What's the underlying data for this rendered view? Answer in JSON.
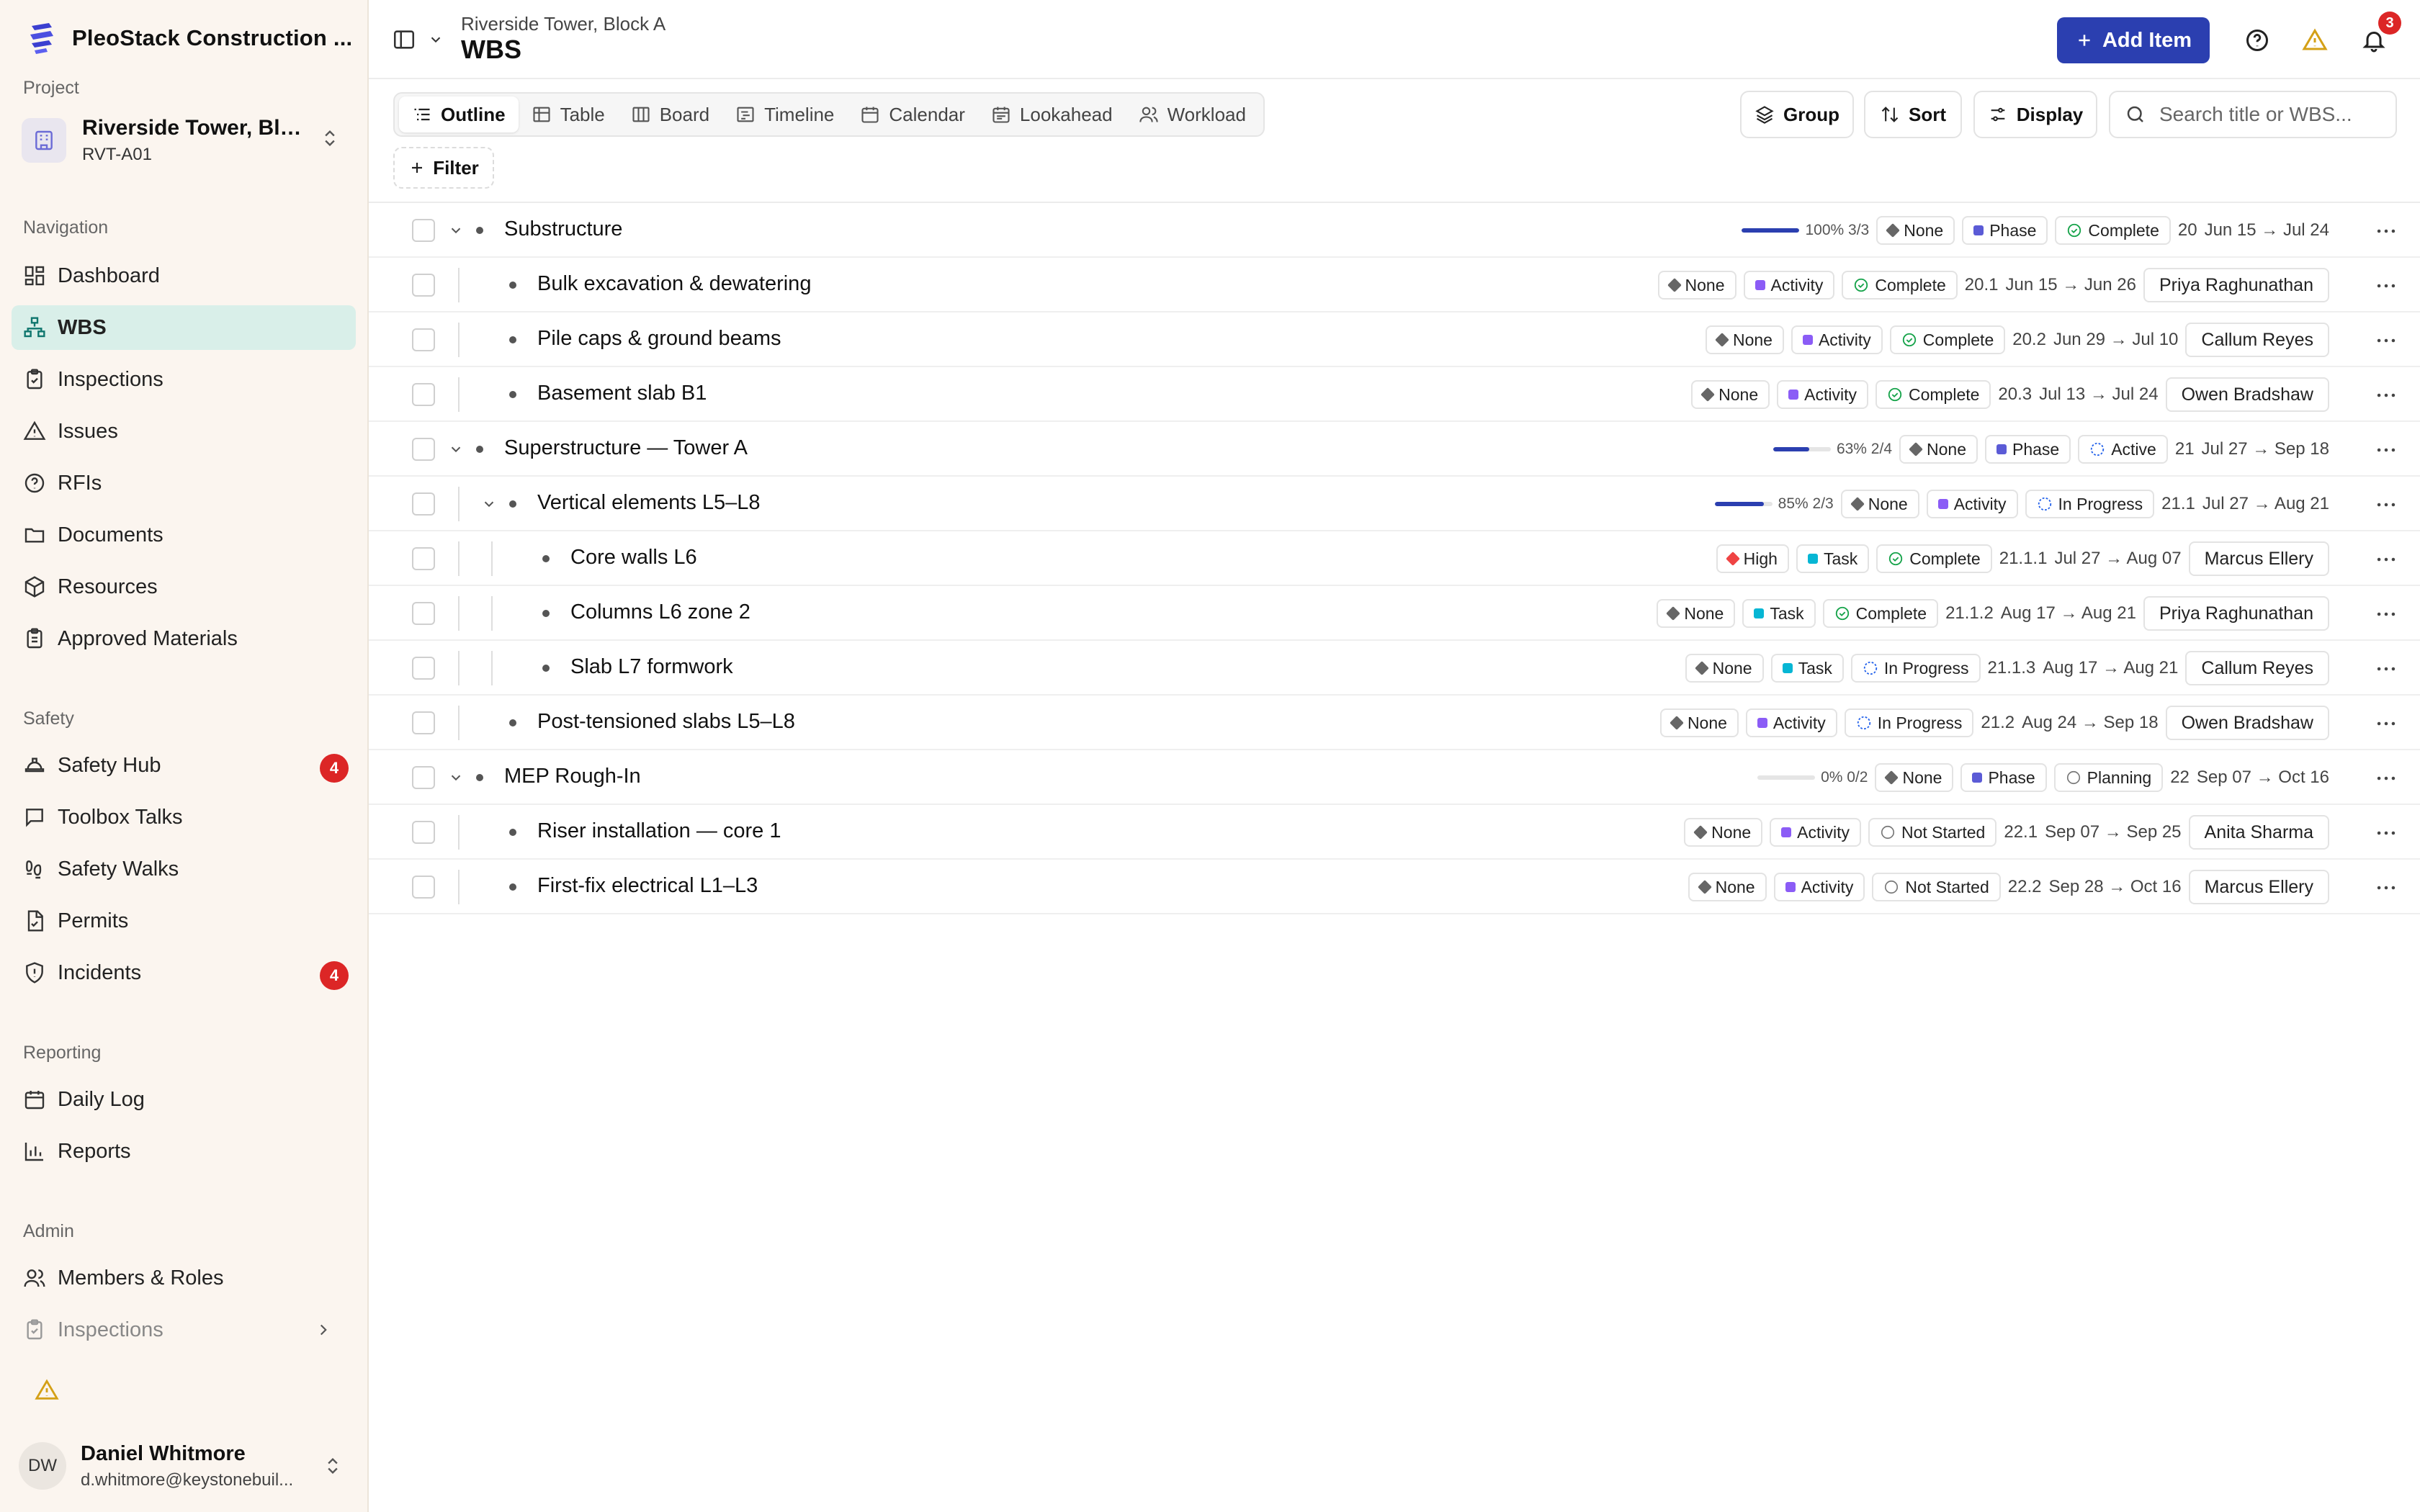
{
  "app": {
    "name": "PleoStack Construction ...",
    "notifications_count": "3"
  },
  "project": {
    "label": "Project",
    "name": "Riverside Tower, Bloc...",
    "code": "RVT-A01"
  },
  "sections": {
    "navigation": "Navigation",
    "safety": "Safety",
    "reporting": "Reporting",
    "admin": "Admin"
  },
  "nav": {
    "dashboard": "Dashboard",
    "wbs": "WBS",
    "inspections": "Inspections",
    "issues": "Issues",
    "rfis": "RFIs",
    "documents": "Documents",
    "resources": "Resources",
    "approved_materials": "Approved Materials",
    "safety_hub": "Safety Hub",
    "safety_hub_badge": "4",
    "toolbox_talks": "Toolbox Talks",
    "safety_walks": "Safety Walks",
    "permits": "Permits",
    "incidents": "Incidents",
    "incidents_badge": "4",
    "daily_log": "Daily Log",
    "reports": "Reports",
    "members_roles": "Members & Roles",
    "admin_inspections": "Inspections"
  },
  "user": {
    "initials": "DW",
    "name": "Daniel Whitmore",
    "email": "d.whitmore@keystonebuil..."
  },
  "header": {
    "breadcrumb": "Riverside Tower, Block A",
    "title": "WBS",
    "add_button": "Add Item"
  },
  "views": [
    "Outline",
    "Table",
    "Board",
    "Timeline",
    "Calendar",
    "Lookahead",
    "Workload"
  ],
  "toolbar": {
    "group": "Group",
    "sort": "Sort",
    "display": "Display",
    "search_placeholder": "Search title or WBS...",
    "filter": "Filter"
  },
  "colors": {
    "accent": "#2b3fb0",
    "active_nav_bg": "#d9efe9",
    "sidebar_bg": "#fbf5ef",
    "badge_red": "#dc2626",
    "phase": "#5b5bd6",
    "activity": "#8b5cf6",
    "task": "#06b6d4",
    "priority_none": "#666666",
    "priority_high": "#ef4444",
    "status_complete": "#16a34a",
    "status_active": "#2563eb"
  },
  "rows": [
    {
      "level": 0,
      "expandable": true,
      "title": "Substructure",
      "progress_pct": 100,
      "progress_text": "100% 3/3",
      "priority": "None",
      "type": "Phase",
      "status": "Complete",
      "wbs": "20",
      "dates": "Jun 15 → Jul 24",
      "assignee": ""
    },
    {
      "level": 1,
      "expandable": false,
      "title": "Bulk excavation & dewatering",
      "priority": "None",
      "type": "Activity",
      "status": "Complete",
      "wbs": "20.1",
      "dates": "Jun 15 → Jun 26",
      "assignee": "Priya Raghunathan"
    },
    {
      "level": 1,
      "expandable": false,
      "title": "Pile caps & ground beams",
      "priority": "None",
      "type": "Activity",
      "status": "Complete",
      "wbs": "20.2",
      "dates": "Jun 29 → Jul 10",
      "assignee": "Callum Reyes"
    },
    {
      "level": 1,
      "expandable": false,
      "title": "Basement slab B1",
      "priority": "None",
      "type": "Activity",
      "status": "Complete",
      "wbs": "20.3",
      "dates": "Jul 13 → Jul 24",
      "assignee": "Owen Bradshaw"
    },
    {
      "level": 0,
      "expandable": true,
      "title": "Superstructure — Tower A",
      "progress_pct": 63,
      "progress_text": "63% 2/4",
      "priority": "None",
      "type": "Phase",
      "status": "Active",
      "wbs": "21",
      "dates": "Jul 27 → Sep 18",
      "assignee": ""
    },
    {
      "level": 1,
      "expandable": true,
      "title": "Vertical elements L5–L8",
      "progress_pct": 85,
      "progress_text": "85% 2/3",
      "priority": "None",
      "type": "Activity",
      "status": "In Progress",
      "wbs": "21.1",
      "dates": "Jul 27 → Aug 21",
      "assignee": ""
    },
    {
      "level": 2,
      "expandable": false,
      "title": "Core walls L6",
      "priority": "High",
      "type": "Task",
      "status": "Complete",
      "wbs": "21.1.1",
      "dates": "Jul 27 → Aug 07",
      "assignee": "Marcus Ellery"
    },
    {
      "level": 2,
      "expandable": false,
      "title": "Columns L6 zone 2",
      "priority": "None",
      "type": "Task",
      "status": "Complete",
      "wbs": "21.1.2",
      "dates": "Aug 17 → Aug 21",
      "assignee": "Priya Raghunathan"
    },
    {
      "level": 2,
      "expandable": false,
      "title": "Slab L7 formwork",
      "priority": "None",
      "type": "Task",
      "status": "In Progress",
      "wbs": "21.1.3",
      "dates": "Aug 17 → Aug 21",
      "assignee": "Callum Reyes"
    },
    {
      "level": 1,
      "expandable": false,
      "title": "Post-tensioned slabs L5–L8",
      "priority": "None",
      "type": "Activity",
      "status": "In Progress",
      "wbs": "21.2",
      "dates": "Aug 24 → Sep 18",
      "assignee": "Owen Bradshaw"
    },
    {
      "level": 0,
      "expandable": true,
      "title": "MEP Rough-In",
      "progress_pct": 0,
      "progress_text": "0% 0/2",
      "priority": "None",
      "type": "Phase",
      "status": "Planning",
      "wbs": "22",
      "dates": "Sep 07 → Oct 16",
      "assignee": ""
    },
    {
      "level": 1,
      "expandable": false,
      "title": "Riser installation — core 1",
      "priority": "None",
      "type": "Activity",
      "status": "Not Started",
      "wbs": "22.1",
      "dates": "Sep 07 → Sep 25",
      "assignee": "Anita Sharma"
    },
    {
      "level": 1,
      "expandable": false,
      "title": "First-fix electrical L1–L3",
      "priority": "None",
      "type": "Activity",
      "status": "Not Started",
      "wbs": "22.2",
      "dates": "Sep 28 → Oct 16",
      "assignee": "Marcus Ellery"
    }
  ]
}
